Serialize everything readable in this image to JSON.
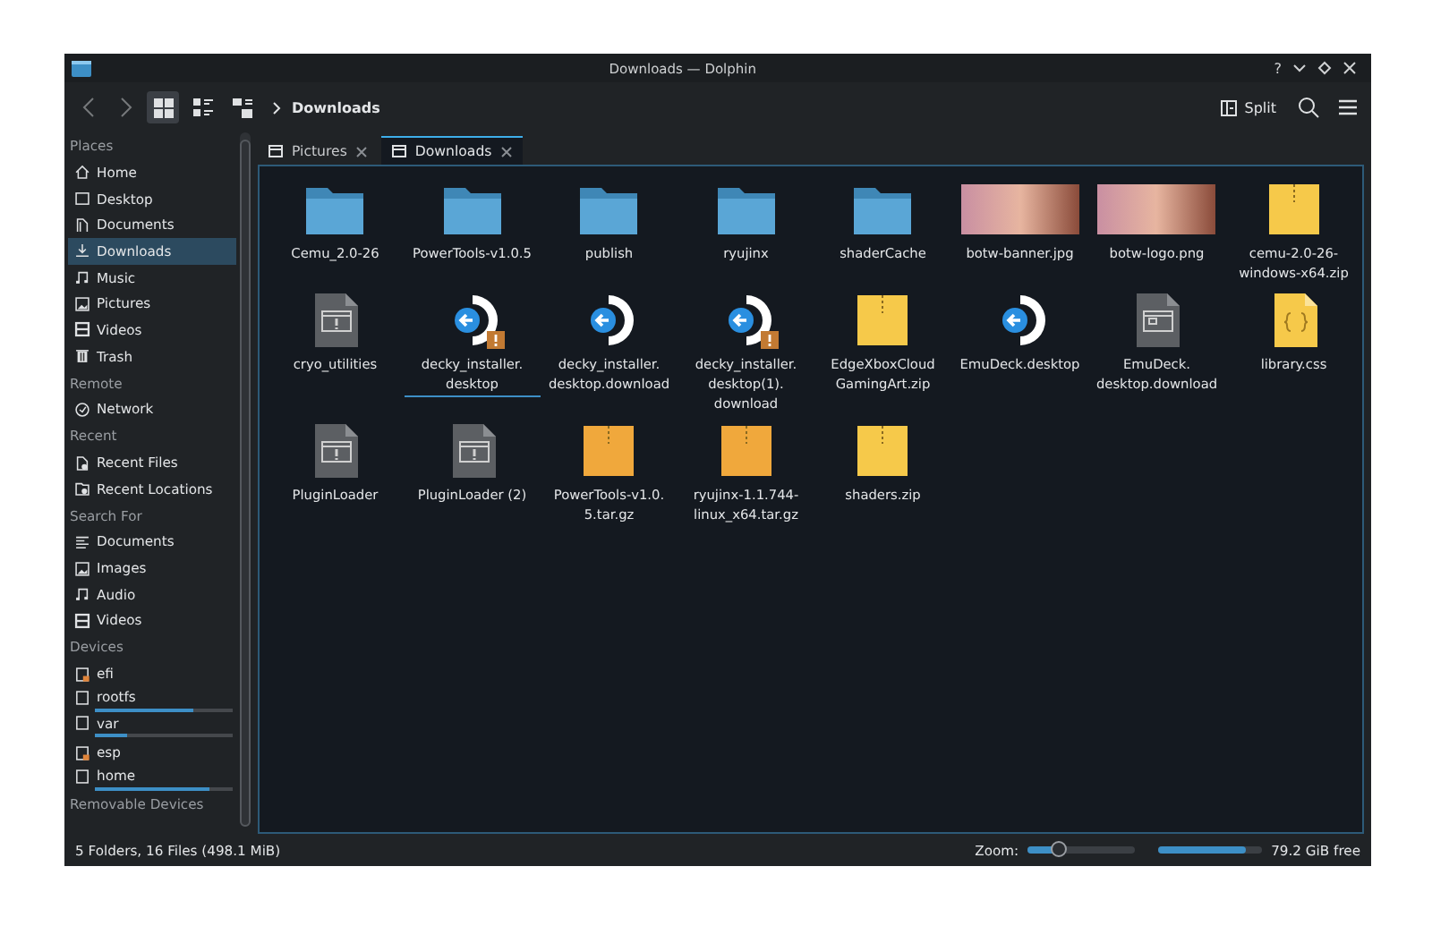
{
  "window": {
    "title": "Downloads — Dolphin",
    "help": "?"
  },
  "toolbar": {
    "back_disabled": true,
    "forward_disabled": true,
    "view_modes": [
      {
        "kind": "icons",
        "selected": true
      },
      {
        "kind": "compact",
        "selected": false
      },
      {
        "kind": "details",
        "selected": false
      }
    ],
    "breadcrumb": "Downloads",
    "split": "Split"
  },
  "sidebar": {
    "sections": [
      {
        "title": "Places",
        "items": [
          {
            "label": "Home",
            "kind": "home",
            "selected": false
          },
          {
            "label": "Desktop",
            "kind": "desktop",
            "selected": false
          },
          {
            "label": "Documents",
            "kind": "documents",
            "selected": false
          },
          {
            "label": "Downloads",
            "kind": "downloads",
            "selected": true
          },
          {
            "label": "Music",
            "kind": "music",
            "selected": false
          },
          {
            "label": "Pictures",
            "kind": "pictures",
            "selected": false
          },
          {
            "label": "Videos",
            "kind": "videos",
            "selected": false
          },
          {
            "label": "Trash",
            "kind": "trash",
            "selected": false
          }
        ]
      },
      {
        "title": "Remote",
        "items": [
          {
            "label": "Network",
            "kind": "network",
            "selected": false
          }
        ]
      },
      {
        "title": "Recent",
        "items": [
          {
            "label": "Recent Files",
            "kind": "recent-files",
            "selected": false
          },
          {
            "label": "Recent Locations",
            "kind": "recent-locations",
            "selected": false
          }
        ]
      },
      {
        "title": "Search For",
        "items": [
          {
            "label": "Documents",
            "kind": "text",
            "selected": false
          },
          {
            "label": "Images",
            "kind": "pictures",
            "selected": false
          },
          {
            "label": "Audio",
            "kind": "music",
            "selected": false
          },
          {
            "label": "Videos",
            "kind": "videos",
            "selected": false
          }
        ]
      },
      {
        "title": "Devices",
        "items": [
          {
            "label": "efi",
            "kind": "drive",
            "selected": false
          },
          {
            "label": "rootfs",
            "kind": "disk",
            "selected": false,
            "level": 0.72
          },
          {
            "label": "var",
            "kind": "disk",
            "selected": false,
            "level": 0.23
          },
          {
            "label": "esp",
            "kind": "drive",
            "selected": false
          },
          {
            "label": "home",
            "kind": "disk",
            "selected": false,
            "level": 0.83
          }
        ]
      },
      {
        "title": "Removable Devices"
      }
    ]
  },
  "tabs": [
    {
      "label": "Pictures",
      "selected": false
    },
    {
      "label": "Downloads",
      "selected": true
    }
  ],
  "files": [
    {
      "name": "Cemu_2.0-26",
      "kind": "folder",
      "focused": false
    },
    {
      "name": "PowerTools-v1.0.5",
      "kind": "folder",
      "focused": false
    },
    {
      "name": "publish",
      "kind": "folder",
      "focused": false
    },
    {
      "name": "ryujinx",
      "kind": "folder",
      "focused": false
    },
    {
      "name": "shaderCache",
      "kind": "folder",
      "focused": false
    },
    {
      "name": "botw-banner.jpg",
      "kind": "image",
      "focused": false
    },
    {
      "name": "botw-logo.png",
      "kind": "image",
      "focused": false
    },
    {
      "name": "cemu-2.0-26-windows-x64.zip",
      "kind": "zip",
      "focused": false
    },
    {
      "name": "cryo_utilities",
      "kind": "executable",
      "focused": false
    },
    {
      "name": "decky_installer.desktop",
      "kind": "launcher",
      "warning": true,
      "focused": true
    },
    {
      "name": "decky_installer.desktop.download",
      "kind": "launcher",
      "warning": false,
      "focused": false
    },
    {
      "name": "decky_installer.desktop(1).download",
      "kind": "launcher",
      "warning": true,
      "focused": false
    },
    {
      "name": "EdgeXboxCloudGamingArt.zip",
      "kind": "zip",
      "focused": false
    },
    {
      "name": "EmuDeck.desktop",
      "kind": "launcher",
      "warning": false,
      "focused": false
    },
    {
      "name": "EmuDeck.desktop.download",
      "kind": "document",
      "focused": false
    },
    {
      "name": "library.css",
      "kind": "css",
      "focused": false
    },
    {
      "name": "PluginLoader",
      "kind": "executable",
      "focused": false
    },
    {
      "name": "PluginLoader (2)",
      "kind": "executable",
      "focused": false
    },
    {
      "name": "PowerTools-v1.0.5.tar.gz",
      "kind": "tarball",
      "focused": false
    },
    {
      "name": "ryujinx-1.1.744-linux_x64.tar.gz",
      "kind": "tarball",
      "focused": false
    },
    {
      "name": "shaders.zip",
      "kind": "zip",
      "focused": false
    }
  ],
  "status_bar": {
    "summary": "5 Folders, 16 Files (498.1 MiB)",
    "zoom_label": "Zoom:",
    "zoom": {
      "level": 0.3
    },
    "free_space": {
      "level": 0.85,
      "label": "79.2 GiB free"
    }
  }
}
